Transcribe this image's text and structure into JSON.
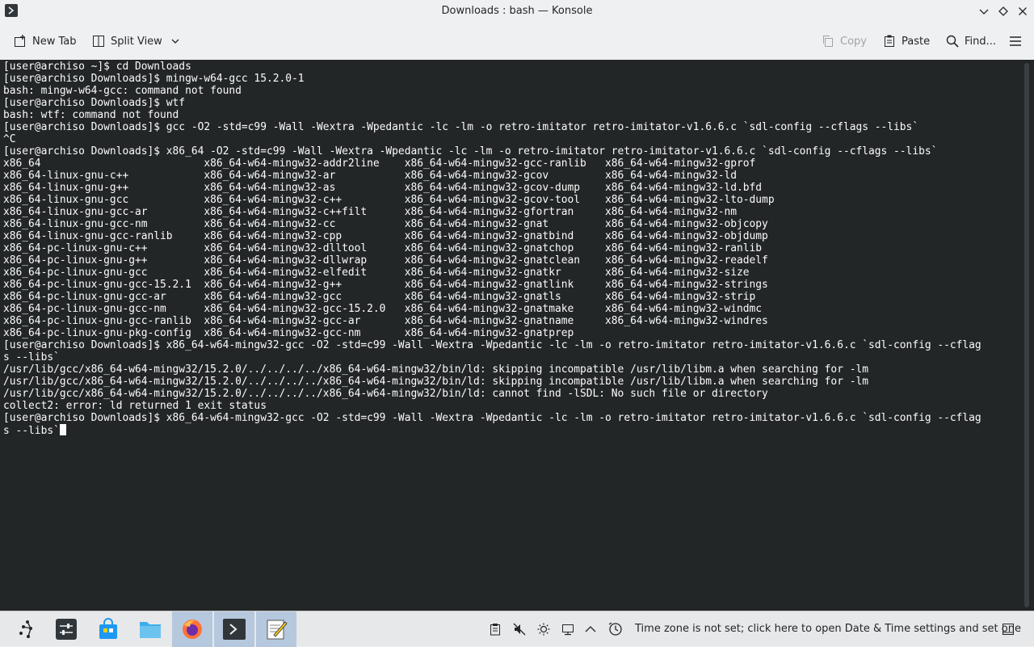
{
  "window": {
    "title": "Downloads : bash — Konsole"
  },
  "toolbar": {
    "new_tab_label": "New Tab",
    "split_view_label": "Split View",
    "copy_label": "Copy",
    "paste_label": "Paste",
    "find_label": "Find..."
  },
  "terminal": {
    "lines": [
      "[user@archiso ~]$ cd Downloads",
      "[user@archiso Downloads]$ mingw-w64-gcc 15.2.0-1",
      "bash: mingw-w64-gcc: command not found",
      "[user@archiso Downloads]$ wtf",
      "bash: wtf: command not found",
      "[user@archiso Downloads]$ gcc -O2 -std=c99 -Wall -Wextra -Wpedantic -lc -lm -o retro-imitator retro-imitator-v1.6.6.c `sdl-config --cflags --libs`",
      "^C",
      "[user@archiso Downloads]$ x86_64 -O2 -std=c99 -Wall -Wextra -Wpedantic -lc -lm -o retro-imitator retro-imitator-v1.6.6.c `sdl-config --cflags --libs`",
      "x86_64                          x86_64-w64-mingw32-addr2line    x86_64-w64-mingw32-gcc-ranlib   x86_64-w64-mingw32-gprof",
      "x86_64-linux-gnu-c++            x86_64-w64-mingw32-ar           x86_64-w64-mingw32-gcov         x86_64-w64-mingw32-ld",
      "x86_64-linux-gnu-g++            x86_64-w64-mingw32-as           x86_64-w64-mingw32-gcov-dump    x86_64-w64-mingw32-ld.bfd",
      "x86_64-linux-gnu-gcc            x86_64-w64-mingw32-c++          x86_64-w64-mingw32-gcov-tool    x86_64-w64-mingw32-lto-dump",
      "x86_64-linux-gnu-gcc-ar         x86_64-w64-mingw32-c++filt      x86_64-w64-mingw32-gfortran     x86_64-w64-mingw32-nm",
      "x86_64-linux-gnu-gcc-nm         x86_64-w64-mingw32-cc           x86_64-w64-mingw32-gnat         x86_64-w64-mingw32-objcopy",
      "x86_64-linux-gnu-gcc-ranlib     x86_64-w64-mingw32-cpp          x86_64-w64-mingw32-gnatbind     x86_64-w64-mingw32-objdump",
      "x86_64-pc-linux-gnu-c++         x86_64-w64-mingw32-dlltool      x86_64-w64-mingw32-gnatchop     x86_64-w64-mingw32-ranlib",
      "x86_64-pc-linux-gnu-g++         x86_64-w64-mingw32-dllwrap      x86_64-w64-mingw32-gnatclean    x86_64-w64-mingw32-readelf",
      "x86_64-pc-linux-gnu-gcc         x86_64-w64-mingw32-elfedit      x86_64-w64-mingw32-gnatkr       x86_64-w64-mingw32-size",
      "x86_64-pc-linux-gnu-gcc-15.2.1  x86_64-w64-mingw32-g++          x86_64-w64-mingw32-gnatlink     x86_64-w64-mingw32-strings",
      "x86_64-pc-linux-gnu-gcc-ar      x86_64-w64-mingw32-gcc          x86_64-w64-mingw32-gnatls       x86_64-w64-mingw32-strip",
      "x86_64-pc-linux-gnu-gcc-nm      x86_64-w64-mingw32-gcc-15.2.0   x86_64-w64-mingw32-gnatmake     x86_64-w64-mingw32-windmc",
      "x86_64-pc-linux-gnu-gcc-ranlib  x86_64-w64-mingw32-gcc-ar       x86_64-w64-mingw32-gnatname     x86_64-w64-mingw32-windres",
      "x86_64-pc-linux-gnu-pkg-config  x86_64-w64-mingw32-gcc-nm       x86_64-w64-mingw32-gnatprep",
      "[user@archiso Downloads]$ x86_64-w64-mingw32-gcc -O2 -std=c99 -Wall -Wextra -Wpedantic -lc -lm -o retro-imitator retro-imitator-v1.6.6.c `sdl-config --cflag",
      "s --libs`",
      "/usr/lib/gcc/x86_64-w64-mingw32/15.2.0/../../../../x86_64-w64-mingw32/bin/ld: skipping incompatible /usr/lib/libm.a when searching for -lm",
      "/usr/lib/gcc/x86_64-w64-mingw32/15.2.0/../../../../x86_64-w64-mingw32/bin/ld: skipping incompatible /usr/lib/libm.a when searching for -lm",
      "/usr/lib/gcc/x86_64-w64-mingw32/15.2.0/../../../../x86_64-w64-mingw32/bin/ld: cannot find -lSDL: No such file or directory",
      "collect2: error: ld returned 1 exit status",
      "[user@archiso Downloads]$ x86_64-w64-mingw32-gcc -O2 -std=c99 -Wall -Wextra -Wpedantic -lc -lm -o retro-imitator retro-imitator-v1.6.6.c `sdl-config --cflag"
    ],
    "last_line": "s --libs`"
  },
  "taskbar": {
    "tray_message": "Time zone is not set; click here to open Date & Time settings and set one"
  },
  "colors": {
    "terminal_bg": "#232627",
    "terminal_fg": "#fcfcfc",
    "chrome_bg": "#eff0f1",
    "active_task": "#b6c8dd"
  }
}
